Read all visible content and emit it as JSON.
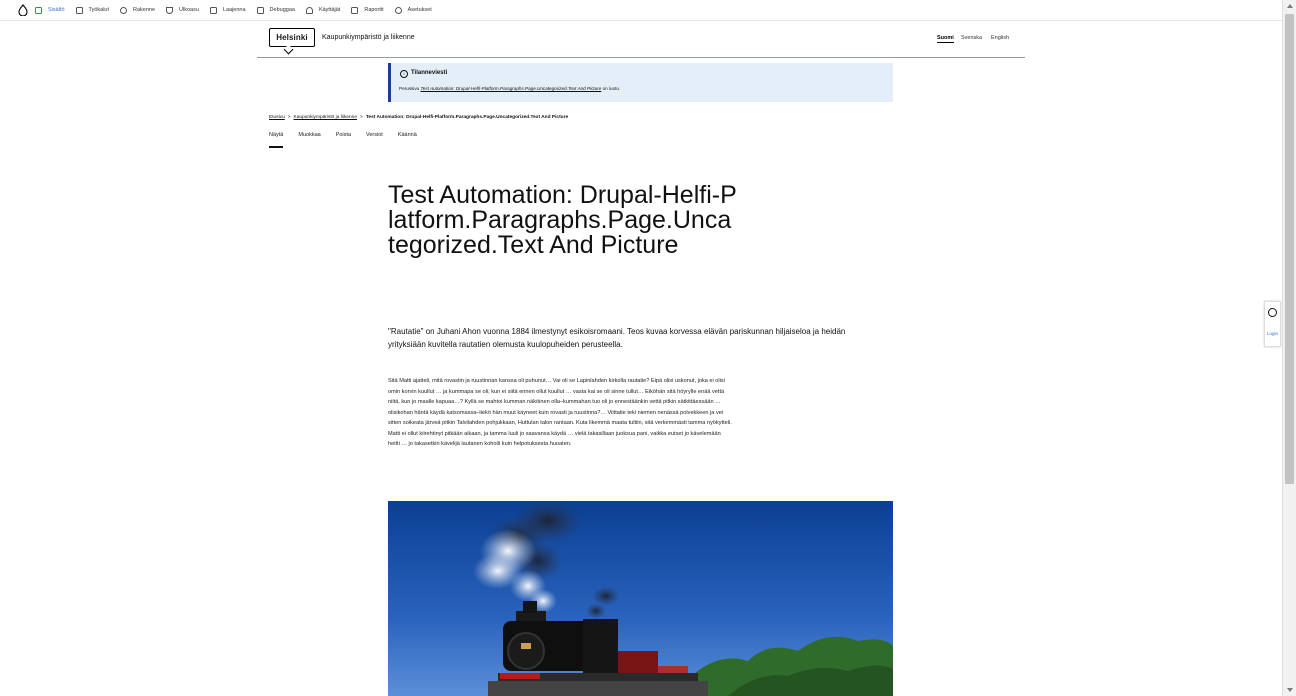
{
  "toolbar": {
    "items": [
      {
        "label": "Sisältö",
        "icon": "content-icon",
        "active": true
      },
      {
        "label": "Työkalut",
        "icon": "tools-icon"
      },
      {
        "label": "Rakenne",
        "icon": "structure-icon"
      },
      {
        "label": "Ulkoasu",
        "icon": "appearance-icon"
      },
      {
        "label": "Laajenna",
        "icon": "extend-icon"
      },
      {
        "label": "Debuggaa",
        "icon": "debug-icon"
      },
      {
        "label": "Käyttäjät",
        "icon": "user-icon"
      },
      {
        "label": "Raportit",
        "icon": "reports-icon"
      },
      {
        "label": "Asetukset",
        "icon": "gear-icon"
      }
    ],
    "accent": "#3b6fd6"
  },
  "header": {
    "logo": "Helsinki",
    "site_name": "Kaupunkiympäristö ja liikenne",
    "languages": [
      "Suomi",
      "Svenska",
      "English"
    ]
  },
  "status": {
    "title": "Tilanneviesti",
    "msg_prefix": "Perussivu",
    "msg_link": "Test Automation: Drupal-Helfi-Platform.Paragraphs.Page.Uncategorized.Text And Picture",
    "msg_suffix": "on luotu.",
    "accent": "#1a3f8f",
    "background": "#e4eef8"
  },
  "breadcrumb": {
    "home": "Etusivu",
    "parent": "Kaupunkiympäristö ja liikenne",
    "current": "Test Automation: Drupal-Helfi-Platform.Paragraphs.Page.Uncategorized.Text And Picture"
  },
  "tabs": [
    "Näytä",
    "Muokkaa",
    "Poista",
    "Versiot",
    "Käännä"
  ],
  "page": {
    "title": "Test Automation: Drupal-Helfi-Platform.Paragraphs.Page.Uncategorized.Text And Picture",
    "lead": "\"Rautatie\" on Juhani Ahon vuonna 1884 ilmestynyt esikoisromaani. Teos kuvaa korvessa elävän pariskunnan hiljaiseloa ja heidän yrityksiään kuvitella rautatien olemusta kuulopuheiden perusteella.",
    "body": "Sitä Matti ajatteli, mitä rovastin ja ruustinnan kanssa oli puhunut… Vai oli se Lapinlahden kirkolla rautatie? Eipä olisi uskonut, joka ei olisi omin korvin kuullut … ja kummapa se oli, kun ei siitä ennen ollut kuullut … vasta kai se oli sinne tullut… Eiköhän sitä höyrylle enää vettä niitä, kun jo maalle kapuaa…? Kyllä se mahtoi kumman näköinen olla–kummahan tuo oli jo ennestäänkin vettä pitkin sätkittäessään … olisikohan häntä käydä katsomassa–liekö hän muut käyneet kuin rovasti ja ruustinna?… Viittatie teki niemen nenässä polvekkeen ja vei sitten soikeata järveä pitkin Talvilahden pohjukkaan, Huttulan talon rantaan. Kuta likemmä maata tultiin, sitä verkemmästi tamma nyökytteli. Matti ei ollut kiirehtinyt pitkään aikaan, ja tamma luuli jo saavansa käydä … vielä takasillaan juoksua pani, vaikka eutset jo kävelemään heitti … jo takasetkin kävelijä lautanen kohoili kuin helpotuksesta huoaten."
  },
  "side_widget": {
    "label": "Login"
  }
}
